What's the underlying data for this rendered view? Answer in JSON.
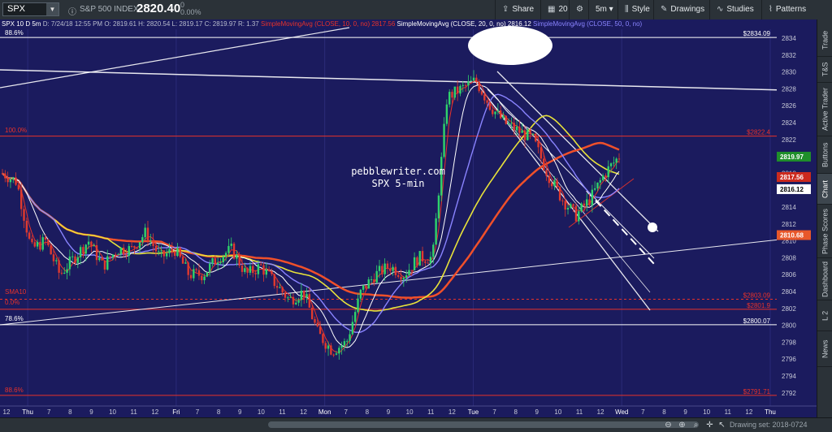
{
  "toolbar": {
    "symbol": "SPX",
    "index_name": "S&P 500 INDEX",
    "price": "2820.40",
    "change_value": "0",
    "change_pct": "0.00%",
    "buttons": [
      {
        "name": "share-button",
        "label": "Share",
        "icon": "share-icon"
      },
      {
        "name": "grid-button",
        "label": "20",
        "icon": "grid-icon"
      },
      {
        "name": "settings-button",
        "label": "",
        "icon": "gear-icon"
      },
      {
        "name": "timeframe-button",
        "label": "5m",
        "icon": ""
      },
      {
        "name": "style-button",
        "label": "Style",
        "icon": "candle-icon"
      },
      {
        "name": "drawings-button",
        "label": "Drawings",
        "icon": "pencil-icon"
      },
      {
        "name": "studies-button",
        "label": "Studies",
        "icon": "studies-icon"
      },
      {
        "name": "patterns-button",
        "label": "Patterns",
        "icon": "patterns-icon"
      }
    ]
  },
  "info_line": {
    "header": "SPX 10 D 5m",
    "date": "D: 7/24/18 12:55 PM",
    "open": "O: 2819.61",
    "high": "H: 2820.54",
    "low": "L: 2819.17",
    "close": "C: 2819.97",
    "range": "R: 1.37",
    "sma10_label": "SimpleMovingAvg (CLOSE, 10, 0, no)",
    "sma10_value": "2817.56",
    "sma20_label": "SimpleMovingAvg (CLOSE, 20, 0, no)",
    "sma20_value": "2816.12",
    "sma50_label": "SimpleMovingAvg (CLOSE, 50, 0, no)"
  },
  "annotations": {
    "watermark_line1": "pebblewriter.com",
    "watermark_line2": "SPX 5-min",
    "fib_886_top": "88.6%",
    "fib_100": "100.0%",
    "fib_0": "0.0%",
    "fib_786": "78.6%",
    "fib_886_bottom": "88.6%",
    "sma10_tag": "SMA10"
  },
  "price_axis": {
    "ticks": [
      "2834",
      "2832",
      "2830",
      "2828",
      "2826",
      "2824",
      "2822",
      "2820",
      "2818",
      "2816",
      "2814",
      "2812",
      "2810",
      "2808",
      "2806",
      "2804",
      "2802",
      "2800",
      "2798",
      "2796",
      "2794",
      "2792"
    ],
    "line_labels": [
      {
        "name": "label-2834",
        "text": "$2834.09",
        "price": 2834.09,
        "color": "#ffffff",
        "text_color": "#ffffff",
        "bg": ""
      },
      {
        "name": "label-2822",
        "text": "$2822.4",
        "price": 2822.4,
        "color": "#e8322a",
        "text_color": "#e8322a",
        "bg": ""
      },
      {
        "name": "label-2803",
        "text": "$2803.09",
        "price": 2803.09,
        "color": "#e8322a",
        "text_color": "#e8322a",
        "bg": ""
      },
      {
        "name": "label-2801",
        "text": "$2801.9",
        "price": 2801.9,
        "color": "#e8322a",
        "text_color": "#e8322a",
        "bg": ""
      },
      {
        "name": "label-2800",
        "text": "$2800.07",
        "price": 2800.07,
        "color": "#ffffff",
        "text_color": "#ffffff",
        "bg": ""
      },
      {
        "name": "label-2791",
        "text": "$2791.71",
        "price": 2791.71,
        "color": "#e8322a",
        "text_color": "#e8322a",
        "bg": ""
      }
    ],
    "value_tags": [
      {
        "name": "tag-last-price",
        "text": "2819.97",
        "price": 2819.97,
        "bg": "#1f8f2a",
        "fg": "#ffffff"
      },
      {
        "name": "tag-sma10",
        "text": "2817.56",
        "price": 2817.56,
        "bg": "#cc2a1e",
        "fg": "#ffffff"
      },
      {
        "name": "tag-sma20",
        "text": "2816.12",
        "price": 2816.12,
        "bg": "#ffffff",
        "fg": "#000000"
      },
      {
        "name": "tag-sma50",
        "text": "2810.68",
        "price": 2810.68,
        "bg": "#e8572a",
        "fg": "#ffffff"
      }
    ]
  },
  "time_axis": [
    "12",
    "Thu",
    "7",
    "8",
    "9",
    "10",
    "11",
    "12",
    "Fri",
    "7",
    "8",
    "9",
    "10",
    "11",
    "12",
    "Mon",
    "7",
    "8",
    "9",
    "10",
    "11",
    "12",
    "Tue",
    "7",
    "8",
    "9",
    "10",
    "11",
    "12",
    "Wed",
    "7",
    "8",
    "9",
    "10",
    "11",
    "12",
    "Thu"
  ],
  "sidebar_tabs": [
    "Trade",
    "T&S",
    "Active Trader",
    "Buttons",
    "Chart",
    "Phase Scores",
    "Dashboard",
    "L 2",
    "News"
  ],
  "sidebar_active": "Chart",
  "bottom": {
    "drawing_set": "Drawing set: 2018-0724"
  },
  "colors": {
    "background": "#1b1b5e",
    "up_candle": "#2fd36b",
    "down_candle": "#e03a2e",
    "sma10": "#e8322a",
    "sma20": "#ffffff",
    "sma50": "#8a84ff",
    "sma200": "#e8e23a",
    "sma_long": "#f0502a"
  },
  "chart_data": {
    "type": "candlestick",
    "symbol": "SPX",
    "interval": "5m",
    "ylim": [
      2790.5,
      2835.8
    ],
    "series": [
      {
        "name": "SimpleMovingAvg (CLOSE, 10, 0, no)",
        "last": 2817.56
      },
      {
        "name": "SimpleMovingAvg (CLOSE, 20, 0, no)",
        "last": 2816.12
      },
      {
        "name": "SimpleMovingAvg (CLOSE, 50, 0, no)",
        "last": 2816.12
      }
    ],
    "close_path": [
      2818,
      2817,
      2809,
      2810,
      2806,
      2808,
      2810,
      2807,
      2809,
      2809,
      2811,
      2808,
      2809,
      2806,
      2806,
      2808,
      2809,
      2806,
      2807,
      2805,
      2803,
      2804,
      2799,
      2797,
      2798,
      2804,
      2806,
      2807,
      2806,
      2808,
      2808,
      2827,
      2828,
      2829,
      2826,
      2824,
      2823,
      2822,
      2818,
      2815,
      2813,
      2815,
      2818,
      2820
    ],
    "horizontal_levels": [
      2834.09,
      2822.4,
      2803.09,
      2801.9,
      2800.07,
      2791.71
    ]
  }
}
